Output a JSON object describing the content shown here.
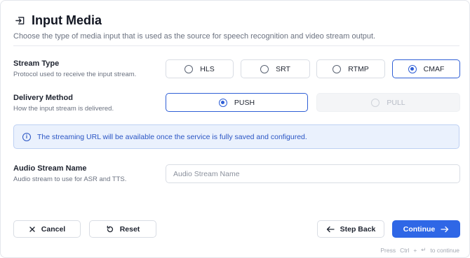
{
  "header": {
    "title": "Input Media",
    "icon": "input-arrow-icon",
    "subtitle": "Choose the type of media input that is used as the source for speech recognition and video stream output."
  },
  "stream_type": {
    "label": "Stream Type",
    "hint": "Protocol used to receive the input stream.",
    "options": [
      {
        "label": "HLS",
        "selected": false
      },
      {
        "label": "SRT",
        "selected": false
      },
      {
        "label": "RTMP",
        "selected": false
      },
      {
        "label": "CMAF",
        "selected": true
      }
    ]
  },
  "delivery_method": {
    "label": "Delivery Method",
    "hint": "How the input stream is delivered.",
    "options": [
      {
        "label": "PUSH",
        "selected": true,
        "disabled": false
      },
      {
        "label": "PULL",
        "selected": false,
        "disabled": true
      }
    ]
  },
  "info": {
    "icon": "info-icon",
    "text": "The streaming URL will be available once the service is fully saved and configured."
  },
  "audio_stream": {
    "label": "Audio Stream Name",
    "hint": "Audio stream to use for ASR and TTS.",
    "placeholder": "Audio Stream Name",
    "value": ""
  },
  "footer": {
    "cancel_label": "Cancel",
    "reset_label": "Reset",
    "back_label": "Step Back",
    "continue_label": "Continue",
    "shortcut_press": "Press",
    "shortcut_key1": "Ctrl",
    "shortcut_plus": "+",
    "shortcut_key2": "↵",
    "shortcut_suffix": "to continue"
  },
  "colors": {
    "accent": "#2f67e6",
    "info_bg": "#eaf1fd",
    "info_text": "#2a55c4"
  }
}
